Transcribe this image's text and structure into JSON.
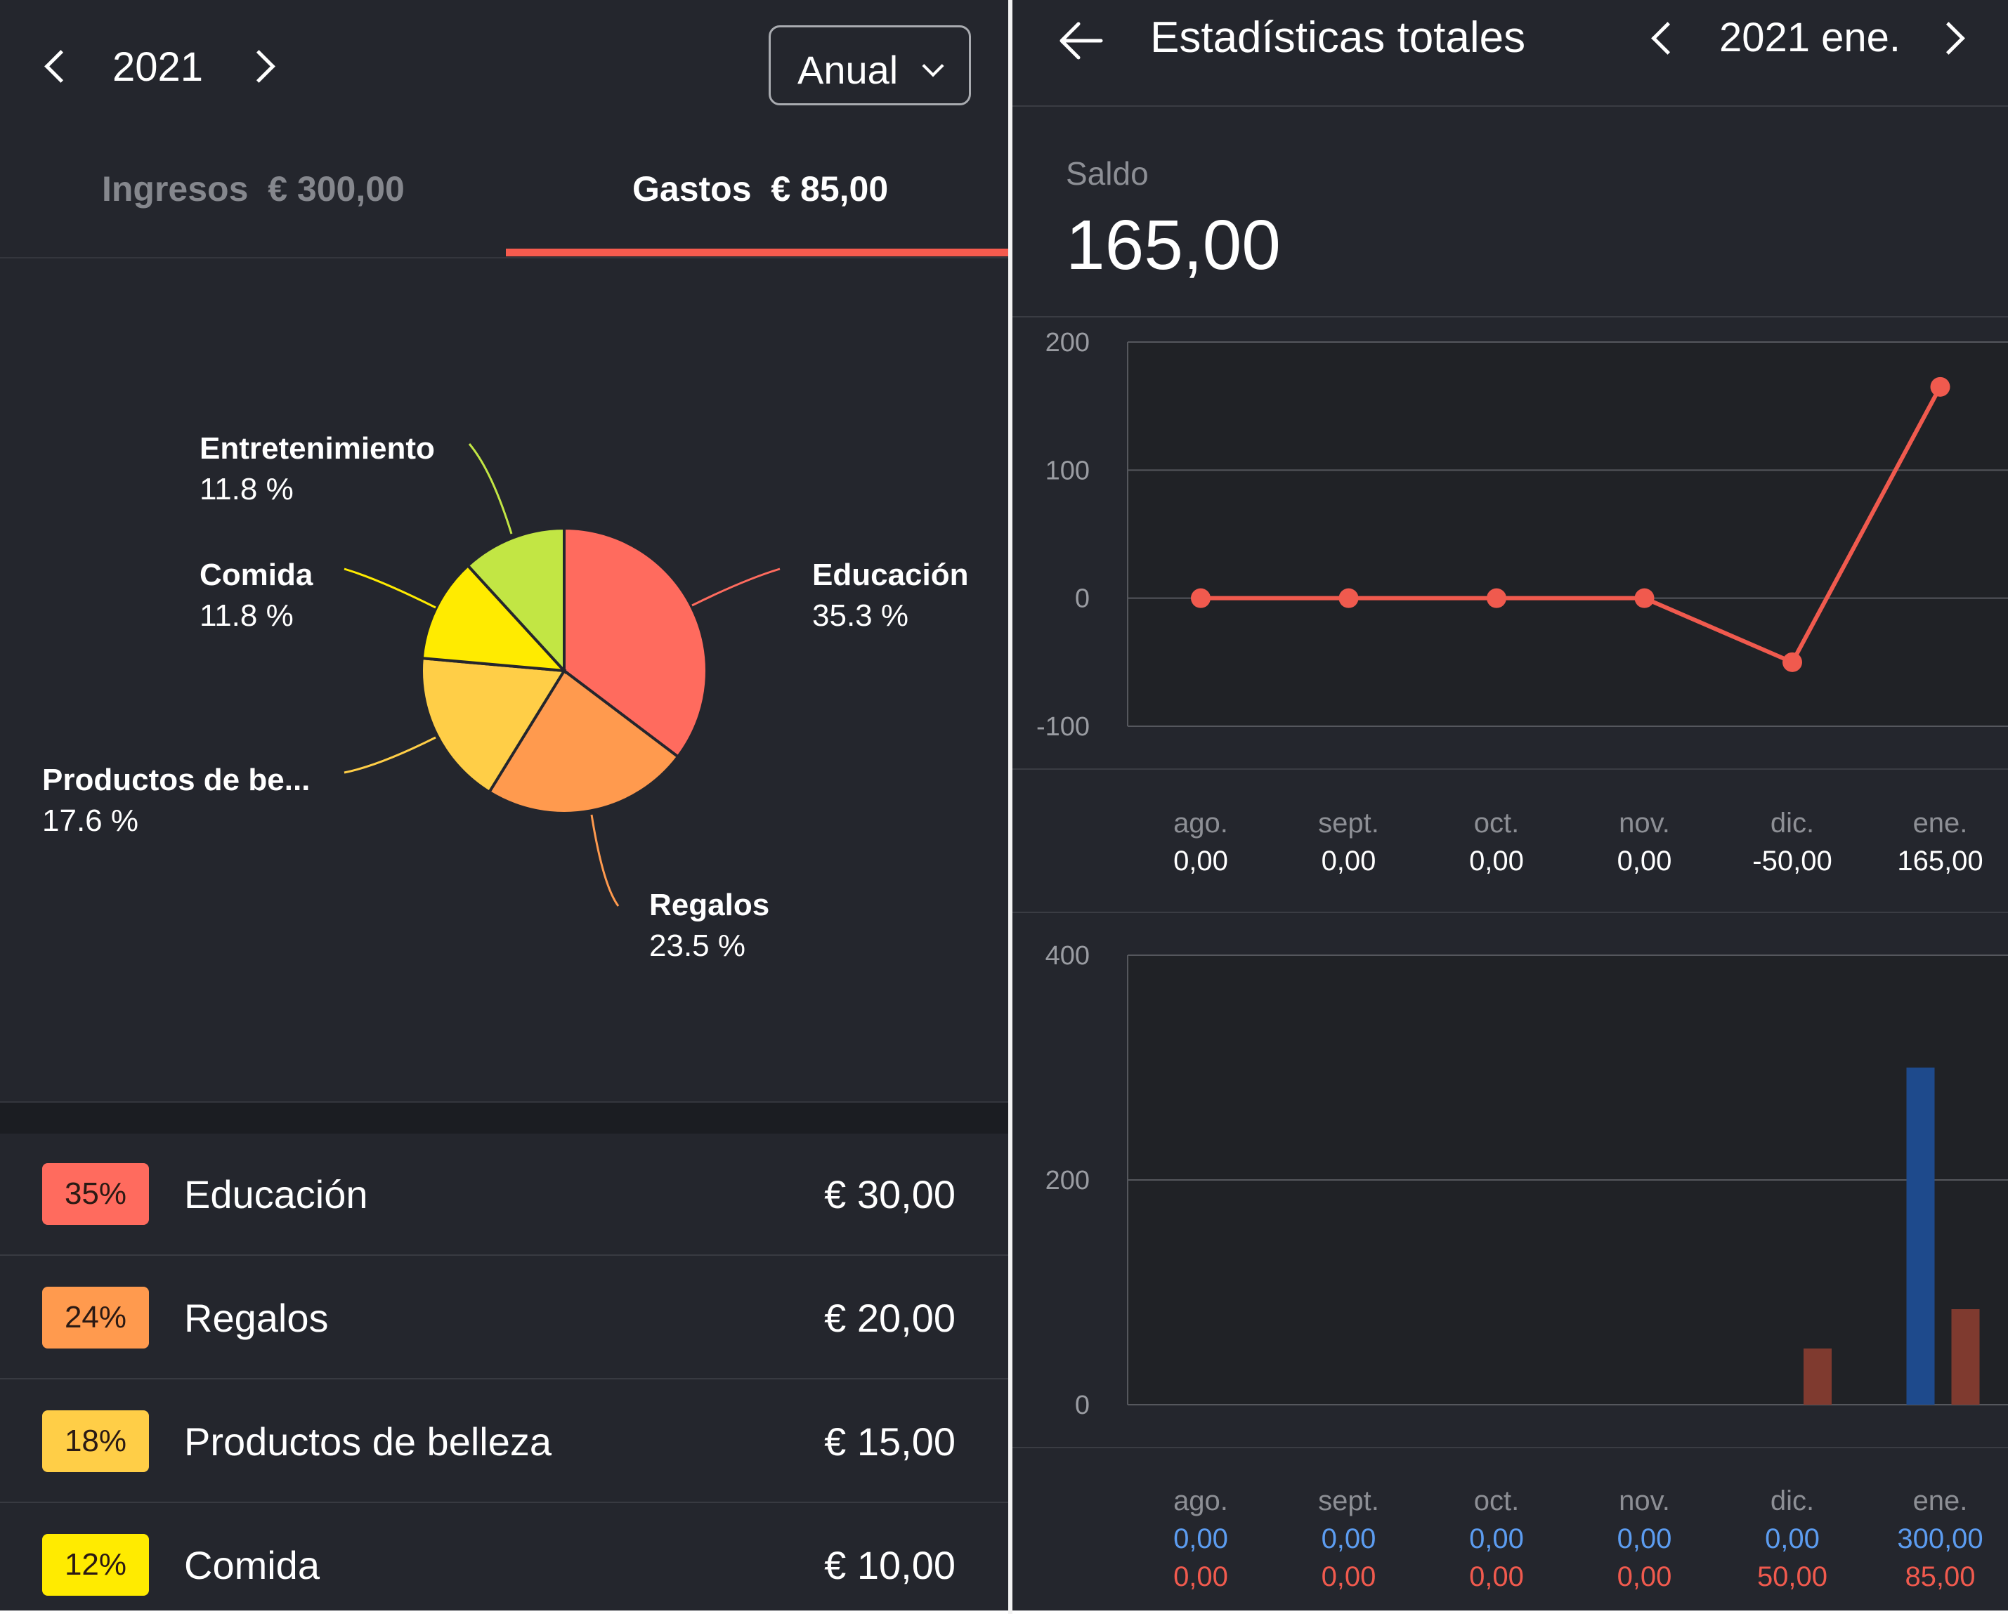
{
  "left": {
    "year": "2021",
    "period_button": "Anual",
    "tabs": {
      "income_label": "Ingresos",
      "income_amount": "€ 300,00",
      "expense_label": "Gastos",
      "expense_amount": "€ 85,00"
    },
    "pie": {
      "slices": [
        {
          "name": "Educación",
          "percent": "35.3 %",
          "value": 35.3,
          "color": "#ff6b5e"
        },
        {
          "name": "Regalos",
          "percent": "23.5 %",
          "value": 23.5,
          "color": "#ff9a4e"
        },
        {
          "name": "Productos de be...",
          "percent": "17.6 %",
          "value": 17.6,
          "color": "#ffce47"
        },
        {
          "name": "Comida",
          "percent": "11.8 %",
          "value": 11.8,
          "color": "#ffeb00"
        },
        {
          "name": "Entretenimiento",
          "percent": "11.8 %",
          "value": 11.8,
          "color": "#c2e644"
        }
      ]
    },
    "categories": [
      {
        "badge": "35%",
        "name": "Educación",
        "amount": "€ 30,00",
        "color": "#ff6b5e"
      },
      {
        "badge": "24%",
        "name": "Regalos",
        "amount": "€ 20,00",
        "color": "#ff9a4e"
      },
      {
        "badge": "18%",
        "name": "Productos de belleza",
        "amount": "€ 15,00",
        "color": "#ffce47"
      },
      {
        "badge": "12%",
        "name": "Comida",
        "amount": "€ 10,00",
        "color": "#ffeb00"
      }
    ]
  },
  "right": {
    "title": "Estadísticas totales",
    "date_nav": "2021 ene.",
    "balance_label": "Saldo",
    "balance_value": "165,00",
    "balance_chart": {
      "months": [
        "ago.",
        "sept.",
        "oct.",
        "nov.",
        "dic.",
        "ene."
      ],
      "value_labels": [
        "0,00",
        "0,00",
        "0,00",
        "0,00",
        "-50,00",
        "165,00"
      ]
    },
    "flow_chart": {
      "months": [
        "ago.",
        "sept.",
        "oct.",
        "nov.",
        "dic.",
        "ene."
      ],
      "income_labels": [
        "0,00",
        "0,00",
        "0,00",
        "0,00",
        "0,00",
        "300,00"
      ],
      "expense_labels": [
        "0,00",
        "0,00",
        "0,00",
        "0,00",
        "50,00",
        "85,00"
      ]
    }
  },
  "chart_data": [
    {
      "type": "pie",
      "categories": [
        "Educación",
        "Regalos",
        "Productos de be...",
        "Comida",
        "Entretenimiento"
      ],
      "values": [
        35.3,
        23.5,
        17.6,
        11.8,
        11.8
      ]
    },
    {
      "type": "line",
      "categories": [
        "ago.",
        "sept.",
        "oct.",
        "nov.",
        "dic.",
        "ene."
      ],
      "values": [
        0,
        0,
        0,
        0,
        -50,
        165
      ],
      "yticks": [
        "200",
        "100",
        "0",
        "-100"
      ],
      "ylim": [
        -100,
        200
      ],
      "grid": true,
      "color": "#f05a4e"
    },
    {
      "type": "bar",
      "categories": [
        "ago.",
        "sept.",
        "oct.",
        "nov.",
        "dic.",
        "ene."
      ],
      "series": [
        {
          "values": [
            0,
            0,
            0,
            0,
            0,
            300
          ],
          "color": "#1e4a8c"
        },
        {
          "values": [
            0,
            0,
            0,
            0,
            50,
            85
          ],
          "color": "#7f3a2f"
        }
      ],
      "yticks": [
        "400",
        "200",
        "0"
      ],
      "ylim": [
        0,
        400
      ],
      "grid": true
    }
  ]
}
